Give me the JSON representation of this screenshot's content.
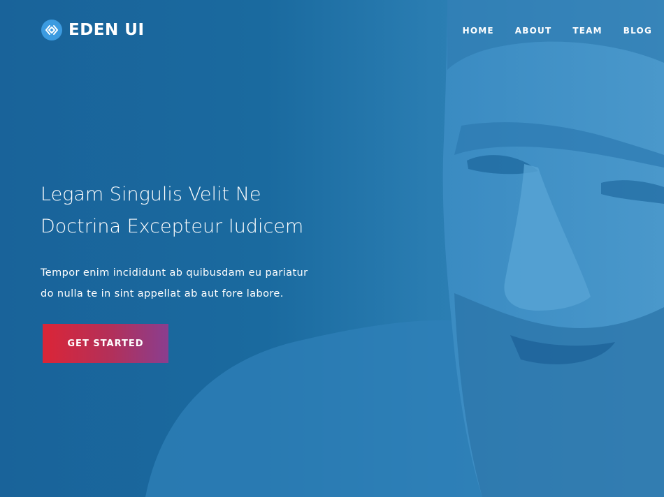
{
  "brand": {
    "name": "EDEN UI",
    "icon": "diamond-link-icon"
  },
  "nav": {
    "items": [
      {
        "label": "HOME"
      },
      {
        "label": "ABOUT"
      },
      {
        "label": "TEAM"
      },
      {
        "label": "BLOG"
      }
    ]
  },
  "hero": {
    "headline_line1": "Legam Singulis Velit Ne",
    "headline_line2": "Doctrina Excepteur Iudicem",
    "subtext_line1": "Tempor enim incididunt ab quibusdam eu pariatur",
    "subtext_line2": "do nulla te in sint appellat ab aut fore labore.",
    "cta_label": "GET STARTED"
  },
  "colors": {
    "background": "#1a6a9f",
    "brand_icon": "#3c9be0",
    "cta_start": "#db2537",
    "cta_end": "#8a3e8f",
    "text": "#ffffff"
  }
}
